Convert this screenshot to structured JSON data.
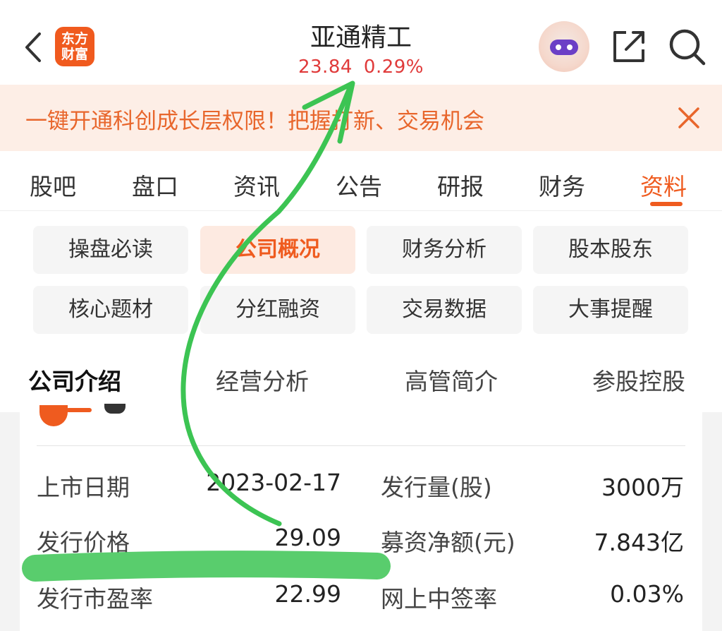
{
  "header": {
    "logo_text": "东方财富",
    "title": "亚通精工",
    "price": "23.84",
    "change_pct": "0.29%",
    "price_color": "#e03a3a"
  },
  "banner": {
    "text": "一键开通科创成长层权限！把握打新、交易机会",
    "color": "#e8662c"
  },
  "tabs": [
    {
      "label": "股吧"
    },
    {
      "label": "盘口"
    },
    {
      "label": "资讯"
    },
    {
      "label": "公告"
    },
    {
      "label": "研报"
    },
    {
      "label": "财务"
    },
    {
      "label": "资料"
    }
  ],
  "active_tab": "资料",
  "sub_tabs": [
    {
      "label": "操盘必读"
    },
    {
      "label": "公司概况"
    },
    {
      "label": "财务分析"
    },
    {
      "label": "股本股东"
    },
    {
      "label": "核心题材"
    },
    {
      "label": "分红融资"
    },
    {
      "label": "交易数据"
    },
    {
      "label": "大事提醒"
    }
  ],
  "section_tabs": [
    {
      "label": "公司介绍"
    },
    {
      "label": "经营分析"
    },
    {
      "label": "高管简介"
    },
    {
      "label": "参股控股"
    }
  ],
  "ipo_info": {
    "rows": [
      {
        "label1": "上市日期",
        "value1": "2023-02-17",
        "label2": "发行量(股)",
        "value2": "3000万"
      },
      {
        "label1": "发行价格",
        "value1": "29.09",
        "label2": "募资净额(元)",
        "value2": "7.843亿"
      },
      {
        "label1": "发行市盈率",
        "value1": "22.99",
        "label2": "网上中签率",
        "value2": "0.03%"
      }
    ]
  },
  "accent_color": "#ef5b1f",
  "annotation_color": "#3cc453"
}
